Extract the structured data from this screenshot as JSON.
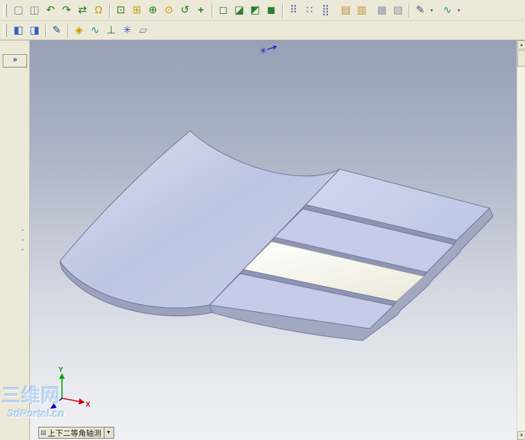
{
  "window": {
    "app_context": "3D CAD part viewport",
    "background": "#ece9d8"
  },
  "colors": {
    "toolbar_bg": "#ece9d8",
    "viewport_top": "#97a0b5",
    "viewport_bottom": "#eff1f4",
    "part_fill": "#c9cfeb",
    "part_white_face": "#f7f7f3",
    "part_riser": "#8e94b2",
    "part_side": "#a2a8c2",
    "part_edge": "#70779a",
    "axis_x": "#cc0000",
    "axis_y": "#00a000",
    "axis_z": "#0000cc",
    "origin_marker": "#1a1acc",
    "watermark": "#c3daf0"
  },
  "ui": {
    "dropdown_glyph": "▾",
    "scroll_up": "▲",
    "scroll_down": "▼",
    "expand_glyph": "»",
    "panel_tab_glyph": "▪"
  },
  "toolbar_row1": {
    "icons": [
      {
        "name": "new-window-icon",
        "glyph": "▢",
        "color": "#76839c"
      },
      {
        "name": "split-view-icon",
        "glyph": "◫",
        "color": "#76839c"
      },
      {
        "name": "previous-view-icon",
        "glyph": "↶",
        "color": "#1e7d1e"
      },
      {
        "name": "next-view-icon",
        "glyph": "↷",
        "color": "#1e7d1e"
      },
      {
        "name": "redraw-icon",
        "glyph": "⇄",
        "color": "#1e7d1e"
      },
      {
        "name": "bell-icon",
        "glyph": "Ω",
        "color": "#c89a00"
      },
      {
        "name": "zoom-fit-icon",
        "glyph": "⊡",
        "color": "#1e7d1e"
      },
      {
        "name": "zoom-area-icon",
        "glyph": "⊞",
        "color": "#c89a00"
      },
      {
        "name": "zoom-in-out-icon",
        "glyph": "⊕",
        "color": "#1e7d1e"
      },
      {
        "name": "zoom-selected-icon",
        "glyph": "⊙",
        "color": "#c89a00"
      },
      {
        "name": "rotate-view-icon",
        "glyph": "↺",
        "color": "#1e7d1e"
      },
      {
        "name": "pan-view-icon",
        "glyph": "+",
        "color": "#1e7d1e"
      },
      {
        "name": "wireframe-icon",
        "glyph": "◻",
        "color": "#2e7d32"
      },
      {
        "name": "hidden-lines-visible-icon",
        "glyph": "◪",
        "color": "#2e7d32"
      },
      {
        "name": "hidden-lines-removed-icon",
        "glyph": "◩",
        "color": "#2e7d32"
      },
      {
        "name": "shaded-view-icon",
        "glyph": "◼",
        "color": "#2e7d32"
      },
      {
        "name": "grid-dots-icon",
        "glyph": "⠿",
        "color": "#4a62a8"
      },
      {
        "name": "point-pattern-icon",
        "glyph": "∷",
        "color": "#4a62a8"
      },
      {
        "name": "dense-pattern-icon",
        "glyph": "⣿",
        "color": "#4a62a8"
      },
      {
        "name": "copy-stack-icon",
        "glyph": "▤",
        "color": "#b8953a"
      },
      {
        "name": "paste-stack-icon",
        "glyph": "▥",
        "color": "#b8953a"
      },
      {
        "name": "ghost-cube-icon",
        "glyph": "▦",
        "color": "#8d94a6"
      },
      {
        "name": "section-cube-icon",
        "glyph": "▧",
        "color": "#8d94a6"
      },
      {
        "name": "measure-tool-icon",
        "glyph": "✎",
        "color": "#44506a"
      },
      {
        "name": "curve-tool-icon",
        "glyph": "∿",
        "color": "#1f8f8f"
      }
    ]
  },
  "toolbar_row2": {
    "icons": [
      {
        "name": "front-view-cube-icon",
        "glyph": "◧",
        "color": "#2f5fc4"
      },
      {
        "name": "iso-view-cube-icon",
        "glyph": "◨",
        "color": "#2f5fc4"
      },
      {
        "name": "sketch-tool-icon",
        "glyph": "✎",
        "color": "#2f4f8f"
      },
      {
        "name": "point-tool-icon",
        "glyph": "◈",
        "color": "#c89a00"
      },
      {
        "name": "spline-tool-icon",
        "glyph": "∿",
        "color": "#1f8f8f"
      },
      {
        "name": "axis-tool-icon",
        "glyph": "⊥",
        "color": "#1e7d1e"
      },
      {
        "name": "star-point-icon",
        "glyph": "✳",
        "color": "#3a56b4"
      },
      {
        "name": "plane-tool-icon",
        "glyph": "▱",
        "color": "#6d7890"
      }
    ]
  },
  "viewport": {
    "origin_glyph": "✳",
    "triad": {
      "x_label": "X",
      "y_label": "Y"
    },
    "watermark_line1": "三维网",
    "watermark_line2": "3dPortal.cn",
    "view_label": {
      "icon": "▤",
      "text": "上下二等角轴测",
      "dropdown": "▼"
    }
  }
}
